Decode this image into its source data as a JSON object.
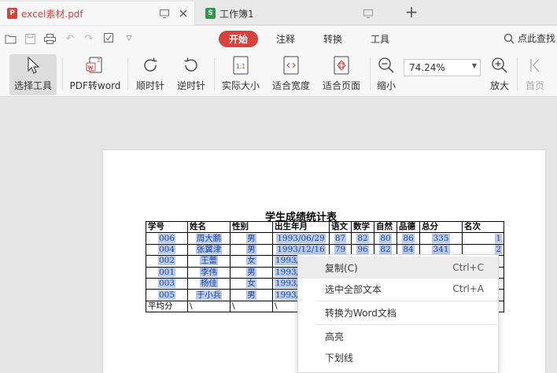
{
  "tabs": [
    {
      "label": "excel素材.pdf",
      "badge": "P",
      "type": "pdf"
    },
    {
      "label": "工作簿1",
      "badge": "S",
      "type": "xls"
    }
  ],
  "menu": {
    "tabs": [
      "开始",
      "注释",
      "转换",
      "工具"
    ],
    "search_hint": "点此查找"
  },
  "ribbon": {
    "select_tool": "选择工具",
    "pdf_to_word": "PDF转word",
    "rotate_cw": "顺时针",
    "rotate_ccw": "逆时针",
    "actual_size": "实际大小",
    "fit_width": "适合宽度",
    "fit_page": "适合页面",
    "zoom_out": "缩小",
    "zoom_value": "74.24%",
    "zoom_in": "放大",
    "first_page": "首页",
    "actual_size_glyph": "1:1"
  },
  "document": {
    "title": "学生成绩统计表",
    "headers": [
      "学号",
      "姓名",
      "性别",
      "出生年月",
      "语文",
      "数学",
      "自然",
      "品德",
      "总分",
      "名次"
    ],
    "rows": [
      [
        "006",
        "周大鹏",
        "男",
        "1993/06/29",
        "87",
        "82",
        "80",
        "86",
        "335",
        "1"
      ],
      [
        "004",
        "张翼津",
        "男",
        "1993/12/16",
        "79",
        "96",
        "82",
        "84",
        "341",
        "2"
      ],
      [
        "002",
        "王蕾",
        "女",
        "1993/",
        "",
        "",
        "",
        "",
        "",
        ""
      ],
      [
        "001",
        "李伟",
        "男",
        "1993/",
        "",
        "",
        "",
        "",
        "",
        ""
      ],
      [
        "003",
        "杨佳",
        "女",
        "1993/",
        "",
        "",
        "",
        "",
        "",
        ""
      ],
      [
        "005",
        "于小兵",
        "男",
        "1993/",
        "",
        "",
        "",
        "",
        "",
        ""
      ]
    ],
    "avg_row": [
      "平均分",
      "\\",
      "\\",
      "\\"
    ]
  },
  "context_menu": {
    "copy": "复制(C)",
    "copy_shortcut": "Ctrl+C",
    "select_all": "选中全部文本",
    "select_all_shortcut": "Ctrl+A",
    "to_word": "转换为Word文档",
    "highlight": "高亮",
    "underline": "下划线"
  }
}
